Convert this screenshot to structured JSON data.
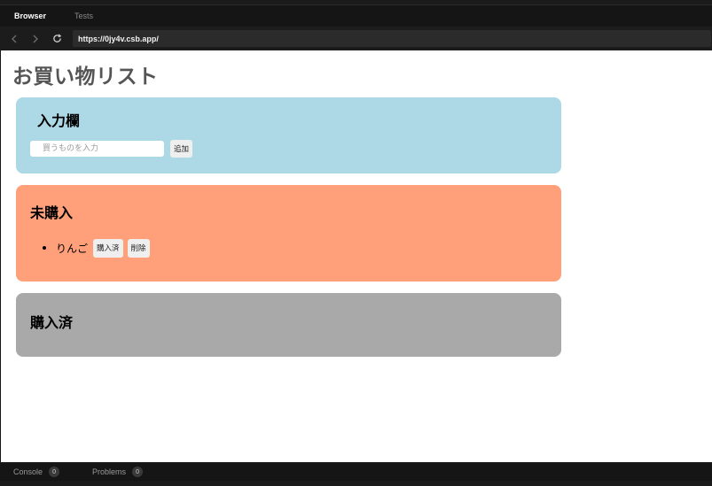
{
  "browser": {
    "tabs": [
      {
        "label": "Browser",
        "active": true
      },
      {
        "label": "Tests",
        "active": false
      }
    ],
    "url": "https://0jy4v.csb.app/",
    "icons": {
      "back": "chevron-left-icon",
      "forward": "chevron-right-icon",
      "reload": "reload-icon"
    }
  },
  "app": {
    "title": "お買い物リスト",
    "input_section": {
      "heading": "入力欄",
      "placeholder": "買うものを入力",
      "value": "",
      "add_label": "追加",
      "color": "#add8e6"
    },
    "pending_section": {
      "heading": "未購入",
      "color": "#ffa07a",
      "items": [
        {
          "name": "りんご",
          "purchased_label": "購入済",
          "delete_label": "削除"
        }
      ]
    },
    "done_section": {
      "heading": "購入済",
      "color": "#a9a9a9",
      "items": []
    }
  },
  "statusbar": {
    "console": {
      "label": "Console",
      "count": "0"
    },
    "problems": {
      "label": "Problems",
      "count": "0"
    }
  }
}
